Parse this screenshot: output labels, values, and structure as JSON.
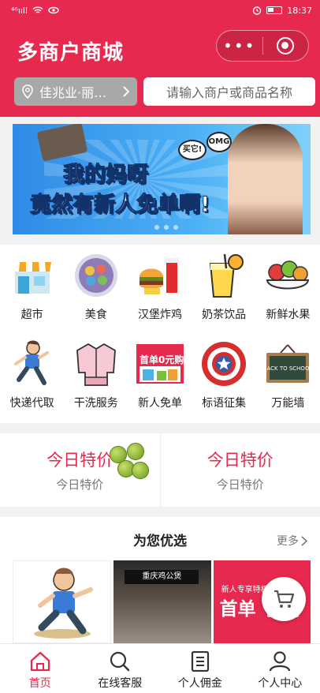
{
  "status_bar": {
    "signal": "⁴⁶ııll",
    "time": "18:37"
  },
  "header": {
    "title": "多商户商城",
    "more_label": "•••",
    "location": "佳兆业·丽…",
    "search_placeholder": "请输入商户或商品名称"
  },
  "banner": {
    "line1": "我的妈呀",
    "line2": "竟然有新人免单啊!",
    "bubble1": "买它!",
    "bubble2": "OMG"
  },
  "categories": [
    {
      "label": "超市",
      "icon": "store-icon"
    },
    {
      "label": "美食",
      "icon": "food-plate-icon"
    },
    {
      "label": "汉堡炸鸡",
      "icon": "burger-icon"
    },
    {
      "label": "奶茶饮品",
      "icon": "drink-icon"
    },
    {
      "label": "新鲜水果",
      "icon": "fruit-icon"
    },
    {
      "label": "快递代取",
      "icon": "courier-runner-icon"
    },
    {
      "label": "干洗服务",
      "icon": "jacket-icon"
    },
    {
      "label": "新人免单",
      "icon": "promo-icon"
    },
    {
      "label": "标语征集",
      "icon": "shield-icon"
    },
    {
      "label": "万能墙",
      "icon": "chalkboard-icon"
    }
  ],
  "promo_icon_text": "首单0元购",
  "chalkboard_text": "BACK TO SCHOOL",
  "specials": [
    {
      "title": "今日特价",
      "subtitle": "今日特价"
    },
    {
      "title": "今日特价",
      "subtitle": "今日特价"
    }
  ],
  "recommend": {
    "title": "为您优选",
    "more": "更多",
    "shop_sign": "重庆鸡公煲",
    "promo_top": "新人专享特权",
    "promo_big": "首单"
  },
  "tabbar": [
    {
      "label": "首页",
      "icon": "home-icon",
      "active": true
    },
    {
      "label": "在线客服",
      "icon": "search-icon",
      "active": false
    },
    {
      "label": "个人佣金",
      "icon": "document-icon",
      "active": false
    },
    {
      "label": "个人中心",
      "icon": "user-icon",
      "active": false
    }
  ],
  "colors": {
    "brand": "#e8294f",
    "location_bg": "#a8a8a8"
  }
}
